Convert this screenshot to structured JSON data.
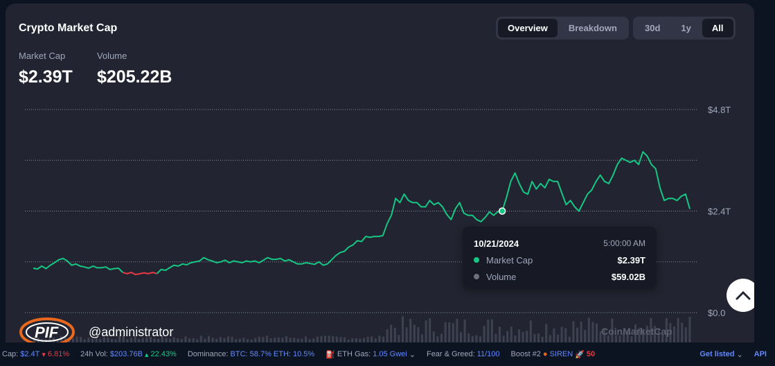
{
  "card": {
    "title": "Crypto Market Cap",
    "view_tabs": [
      {
        "label": "Overview",
        "active": true
      },
      {
        "label": "Breakdown",
        "active": false
      }
    ],
    "range_tabs": [
      {
        "label": "30d",
        "active": false
      },
      {
        "label": "1y",
        "active": false
      },
      {
        "label": "All",
        "active": true
      }
    ],
    "market_cap_label": "Market Cap",
    "market_cap_value": "$2.39T",
    "volume_label": "Volume",
    "volume_value": "$205.22B",
    "watermark": "CoinMarketCap"
  },
  "tooltip": {
    "date": "10/21/2024",
    "time": "5:00:00 AM",
    "rows": [
      {
        "label": "Market Cap",
        "value": "$2.39T",
        "color": "#16c784"
      },
      {
        "label": "Volume",
        "value": "$59.02B",
        "color": "#6b6f7e"
      }
    ]
  },
  "user": {
    "handle": "@administrator",
    "logo_text": "PIF"
  },
  "ticker": {
    "cap_label": "Cap:",
    "cap_value": "$2.4T",
    "cap_change": "6.81%",
    "vol_label": "24h Vol:",
    "vol_value": "$203.76B",
    "vol_change": "22.43%",
    "dominance_label": "Dominance:",
    "dominance_value": "BTC: 58.7% ETH: 10.5%",
    "gas_label": "ETH Gas:",
    "gas_value": "1.05 Gwei",
    "fg_label": "Fear & Greed:",
    "fg_value": "11/100",
    "boost_label": "Boost #2",
    "boost_name": "SIREN",
    "boost_value": "50",
    "get_listed": "Get listed",
    "api": "API"
  },
  "colors": {
    "up": "#16c784",
    "down": "#ea3943",
    "link": "#6188ff"
  },
  "chart_data": {
    "type": "line",
    "y_ticks": [
      "$0.0",
      "$2.4T",
      "$4.8T"
    ],
    "ylim": [
      0,
      4.8
    ],
    "unit": "T",
    "grid": true,
    "series": [
      {
        "values": [
          1.05,
          1.03,
          1.1,
          1.04,
          1.12,
          1.18,
          1.25,
          1.28,
          1.22,
          1.12,
          1.15,
          1.1,
          1.08,
          1.05,
          1.1,
          1.06,
          1.06,
          1.08,
          1.02,
          1.04,
          1.05,
          0.95,
          0.92,
          0.95,
          0.9,
          0.92,
          0.94,
          0.92,
          0.95,
          0.92,
          1.02,
          1.0,
          1.06,
          1.12,
          1.1,
          1.15,
          1.13,
          1.18,
          1.2,
          1.22,
          1.3,
          1.25,
          1.22,
          1.18,
          1.2,
          1.24,
          1.18,
          1.22,
          1.2,
          1.18,
          1.22,
          1.2,
          1.22,
          1.18,
          1.24,
          1.3,
          1.26,
          1.26,
          1.28,
          1.22,
          1.25,
          1.2,
          1.15,
          1.15,
          1.18,
          1.16,
          1.14,
          1.2,
          1.12,
          1.15,
          1.25,
          1.35,
          1.42,
          1.45,
          1.55,
          1.6,
          1.7,
          1.68,
          1.8,
          1.78,
          1.8,
          1.8,
          1.82,
          2.1,
          2.3,
          2.7,
          2.6,
          2.8,
          2.65,
          2.6,
          2.6,
          2.5,
          2.5,
          2.65,
          2.55,
          2.6,
          2.5,
          2.32,
          2.2,
          2.45,
          2.6,
          2.35,
          2.3,
          2.3,
          2.2,
          2.15,
          2.25,
          2.38,
          2.3,
          2.39,
          2.4,
          2.72,
          3.1,
          3.3,
          3.05,
          2.85,
          2.8,
          3.1,
          2.92,
          3.05,
          2.95,
          3.15,
          3.1,
          3.1,
          2.82,
          2.55,
          2.65,
          2.5,
          2.4,
          2.6,
          2.8,
          2.9,
          3.1,
          3.25,
          3.1,
          3.05,
          3.25,
          3.5,
          3.65,
          3.6,
          3.55,
          3.6,
          3.5,
          3.8,
          3.7,
          3.5,
          3.4,
          2.95,
          2.65,
          2.7,
          2.7,
          2.65,
          2.75,
          2.8,
          2.45
        ],
        "down_range": [
          21,
          29
        ]
      }
    ],
    "tooltip_point_index": 110,
    "volume_bars_visible": true
  }
}
